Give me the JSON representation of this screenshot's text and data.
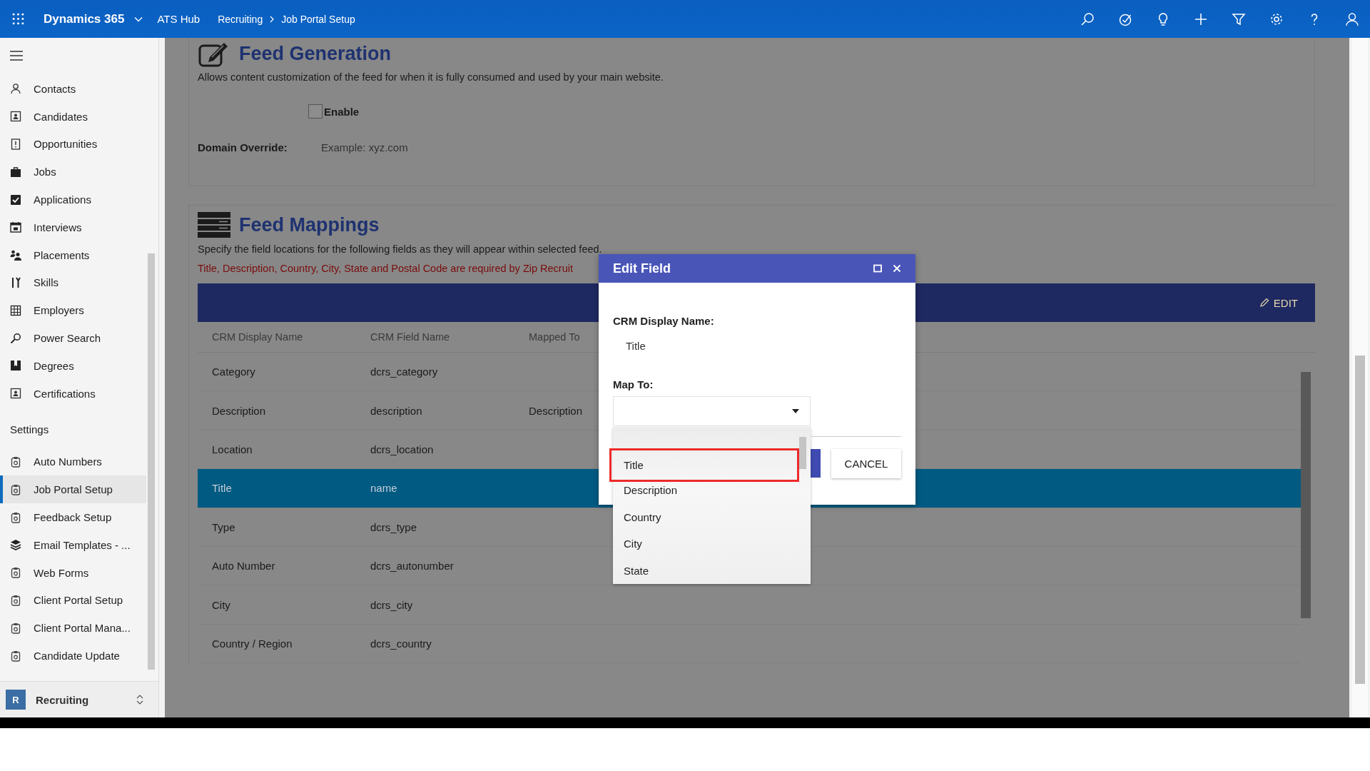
{
  "topbar": {
    "app_name": "Dynamics 365",
    "area": "ATS Hub",
    "breadcrumb": [
      "Recruiting",
      "Job Portal Setup"
    ]
  },
  "sidebar": {
    "items": [
      {
        "label": "Contacts",
        "selected": false
      },
      {
        "label": "Candidates",
        "selected": false
      },
      {
        "label": "Opportunities",
        "selected": false
      },
      {
        "label": "Jobs",
        "selected": false
      },
      {
        "label": "Applications",
        "selected": false
      },
      {
        "label": "Interviews",
        "selected": false
      },
      {
        "label": "Placements",
        "selected": false
      },
      {
        "label": "Skills",
        "selected": false
      },
      {
        "label": "Employers",
        "selected": false
      },
      {
        "label": "Power Search",
        "selected": false
      },
      {
        "label": "Degrees",
        "selected": false
      },
      {
        "label": "Certifications",
        "selected": false
      }
    ],
    "settings_heading": "Settings",
    "settings_items": [
      {
        "label": "Auto Numbers",
        "selected": false
      },
      {
        "label": "Job Portal Setup",
        "selected": true
      },
      {
        "label": "Feedback Setup",
        "selected": false
      },
      {
        "label": "Email Templates - ...",
        "selected": false
      },
      {
        "label": "Web Forms",
        "selected": false
      },
      {
        "label": "Client Portal Setup",
        "selected": false
      },
      {
        "label": "Client Portal Mana...",
        "selected": false
      },
      {
        "label": "Candidate Update",
        "selected": false
      }
    ],
    "area_switcher": {
      "badge": "R",
      "label": "Recruiting"
    }
  },
  "feed_generation": {
    "title": "Feed Generation",
    "description": "Allows content customization of the feed for when it is fully consumed and used by your main website.",
    "enable": {
      "label": "Enable",
      "checked": false
    },
    "domain_override": {
      "label": "Domain Override:",
      "placeholder": "Example: xyz.com"
    }
  },
  "feed_mappings": {
    "title": "Feed Mappings",
    "description": "Specify the field locations for the following fields as they will appear within selected feed.",
    "requirement_note": "Title, Description, Country, City, State and Postal Code are required by Zip Recruit",
    "edit_button": "EDIT",
    "table": {
      "columns": [
        "CRM Display Name",
        "CRM Field Name",
        "Mapped To"
      ],
      "rows": [
        {
          "cells": [
            "Category",
            "dcrs_category",
            ""
          ],
          "selected": false
        },
        {
          "cells": [
            "Description",
            "description",
            "Description"
          ],
          "selected": false
        },
        {
          "cells": [
            "Location",
            "dcrs_location",
            ""
          ],
          "selected": false
        },
        {
          "cells": [
            "Title",
            "name",
            ""
          ],
          "selected": true
        },
        {
          "cells": [
            "Type",
            "dcrs_type",
            ""
          ],
          "selected": false
        },
        {
          "cells": [
            "Auto Number",
            "dcrs_autonumber",
            ""
          ],
          "selected": false
        },
        {
          "cells": [
            "City",
            "dcrs_city",
            ""
          ],
          "selected": false
        },
        {
          "cells": [
            "Country / Region",
            "dcrs_country",
            ""
          ],
          "selected": false
        }
      ]
    }
  },
  "dialog": {
    "title": "Edit Field",
    "display_name_label": "CRM Display Name:",
    "display_name": "Title",
    "map_to_label": "Map To:",
    "cancel_button": "CANCEL",
    "options": [
      {
        "label": "Title",
        "highlighted": true
      },
      {
        "label": "Description",
        "highlighted": false
      },
      {
        "label": "Country",
        "highlighted": false
      },
      {
        "label": "City",
        "highlighted": false
      },
      {
        "label": "State",
        "highlighted": false
      }
    ]
  }
}
